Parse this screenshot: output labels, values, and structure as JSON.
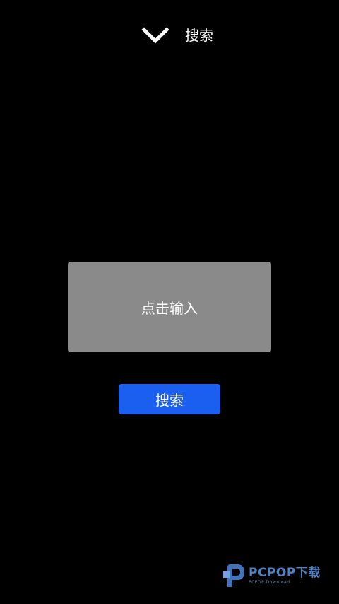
{
  "header": {
    "collapse_icon": "chevron-down-icon",
    "title": "搜索"
  },
  "input": {
    "placeholder": "点击输入",
    "background": "#8a8a8a"
  },
  "search_button": {
    "label": "搜索",
    "color": "#1a5ff0"
  },
  "watermark": {
    "logo_icon": "pcpop-logo-icon",
    "text": "PCPOP下载",
    "subtext": "PCPOP Download",
    "color": "#5a8fd6"
  }
}
